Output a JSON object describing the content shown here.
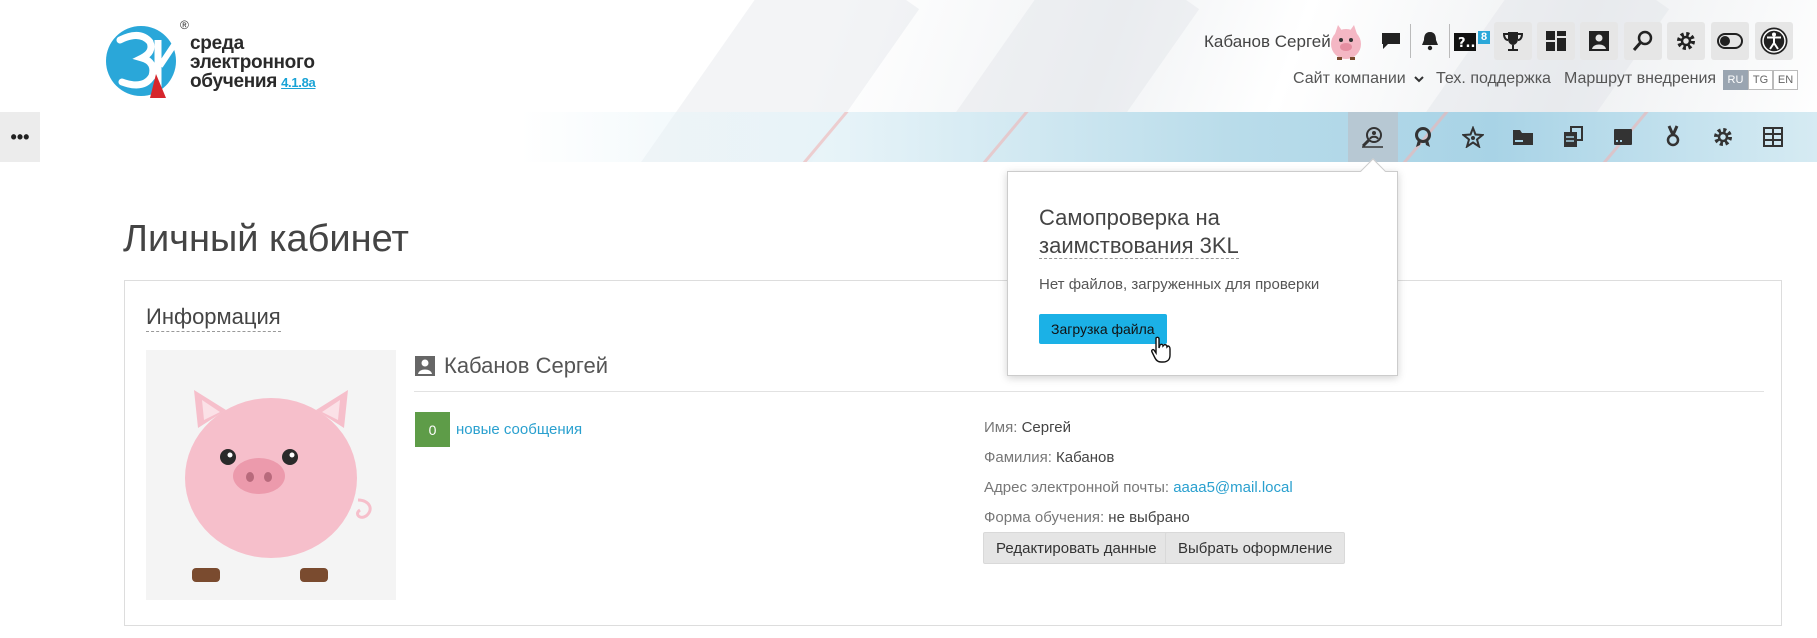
{
  "logo": {
    "line1": "среда",
    "line2": "электронного",
    "line3": "обучения",
    "version": "4.1.8a",
    "reg": "®"
  },
  "header": {
    "user_name": "Кабанов Сергей",
    "badge_count": "8",
    "links": {
      "company_site": "Сайт компании",
      "support": "Тех. поддержка",
      "route": "Маршрут внедрения"
    },
    "languages": [
      "RU",
      "TG",
      "EN"
    ],
    "active_language": "RU"
  },
  "menu_button": "•••",
  "popover": {
    "title_line1": "Самопроверка на",
    "title_line2": "заимствования 3KL",
    "text": "Нет файлов, загруженных для проверки",
    "button": "Загрузка файла"
  },
  "page": {
    "title": "Личный кабинет",
    "section_title": "Информация",
    "profile_name": "Кабанов Сергей",
    "messages_count": "0",
    "messages_link": "новые сообщения",
    "fields": {
      "first_name_label": "Имя:",
      "first_name": "Сергей",
      "last_name_label": "Фамилия:",
      "last_name": "Кабанов",
      "email_label": "Адрес электронной почты:",
      "email": "aaaa5@mail.local",
      "study_form_label": "Форма обучения:",
      "study_form": "не выбрано"
    },
    "buttons": {
      "edit": "Редактировать данные",
      "theme": "Выбрать оформление"
    }
  },
  "colors": {
    "accent": "#1bb1e6",
    "link": "#2aa0cf",
    "messages_badge": "#5e9c48",
    "logo_blue": "#2aa7d9",
    "logo_red": "#d6262c"
  }
}
